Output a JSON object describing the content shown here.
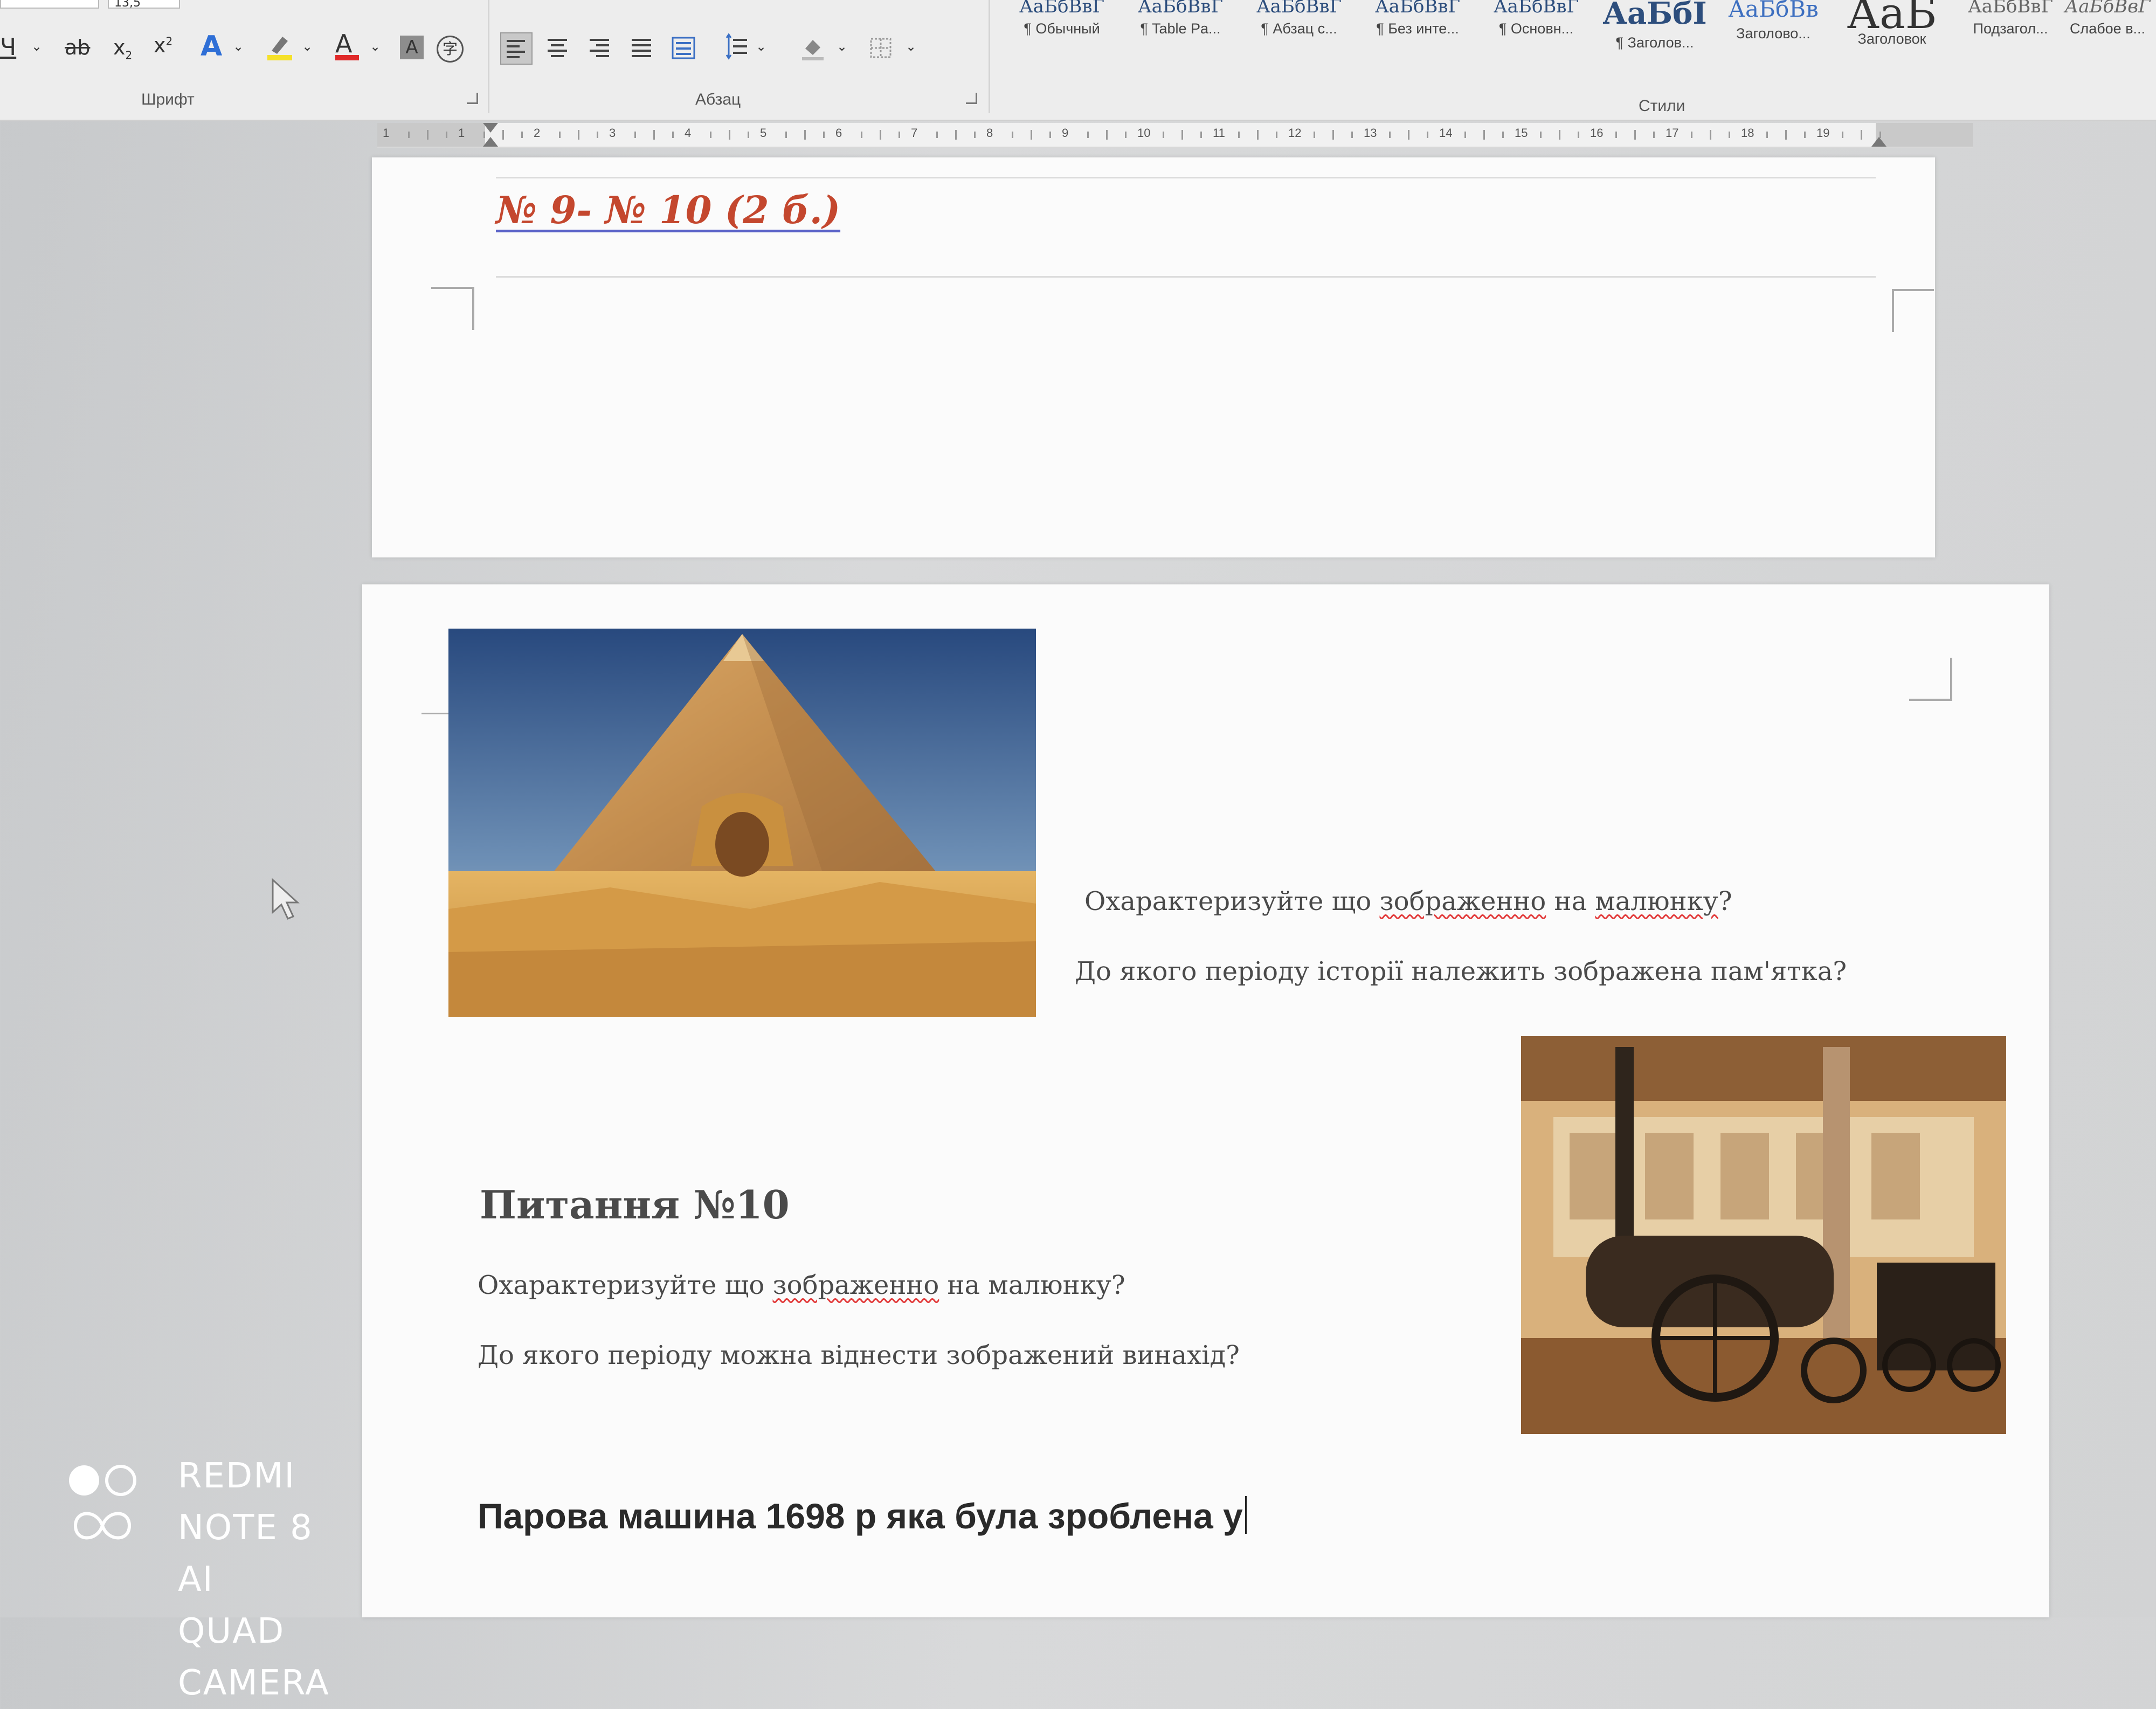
{
  "ribbon": {
    "font_size_value": "13,5",
    "font_group_label": "Шрифт",
    "paragraph_group_label": "Абзац",
    "styles_group_label": "Стили",
    "styles": [
      {
        "preview": "АаБбВвГ",
        "name": "¶ Обычный"
      },
      {
        "preview": "АаБбВвГ",
        "name": "¶ Table Pa..."
      },
      {
        "preview": "АаБбВвГ",
        "name": "¶ Абзац с..."
      },
      {
        "preview": "АаБбВвГ",
        "name": "¶ Без инте..."
      },
      {
        "preview": "АаБбВвГ",
        "name": "¶ Основн..."
      },
      {
        "preview": "АаБбI",
        "name": "¶ Заголов..."
      },
      {
        "preview": "АаБбВв",
        "name": "Заголово..."
      },
      {
        "preview": "АаБ",
        "name": "Заголовок"
      },
      {
        "preview": "АаБбВвГ",
        "name": "Подзагол..."
      },
      {
        "preview": "АаБбВвГ",
        "name": "Слабое в..."
      }
    ]
  },
  "ruler": {
    "numbers": [
      "1",
      "1",
      "2",
      "3",
      "4",
      "5",
      "6",
      "7",
      "8",
      "9",
      "10",
      "11",
      "12",
      "13",
      "14",
      "15",
      "16",
      "17",
      "18",
      "19"
    ]
  },
  "document": {
    "page1": {
      "heading": "№ 9- № 10 (2 б.)"
    },
    "page2": {
      "q9_line1_a": "Охарактеризуйте що ",
      "q9_line1_b": "зображенно",
      "q9_line1_c": " на ",
      "q9_line1_d": "малюнку",
      "q9_line1_e": "?",
      "q9_line2": "До якого періоду історії належить зображена пам'ятка?",
      "q10_heading": "Питання №10",
      "q10_line1_a": "Охарактеризуйте що ",
      "q10_line1_b": "зображенно",
      "q10_line1_c": " на малюнку?",
      "q10_line2": "До якого періоду можна віднести зображений винахід?",
      "answer_text": "Парова машина 1698 р яка була зроблена у"
    }
  },
  "images": {
    "pyramid": "pyramid-and-sphinx-photo",
    "locomotive": "steam-locomotive-in-museum-photo"
  },
  "watermark": {
    "line1": "REDMI NOTE 8",
    "line2": "AI QUAD CAMERA"
  },
  "colors": {
    "heading_red": "#c4472e",
    "doc_text": "#4a4a4a",
    "spell_underline": "#e23b3b"
  }
}
